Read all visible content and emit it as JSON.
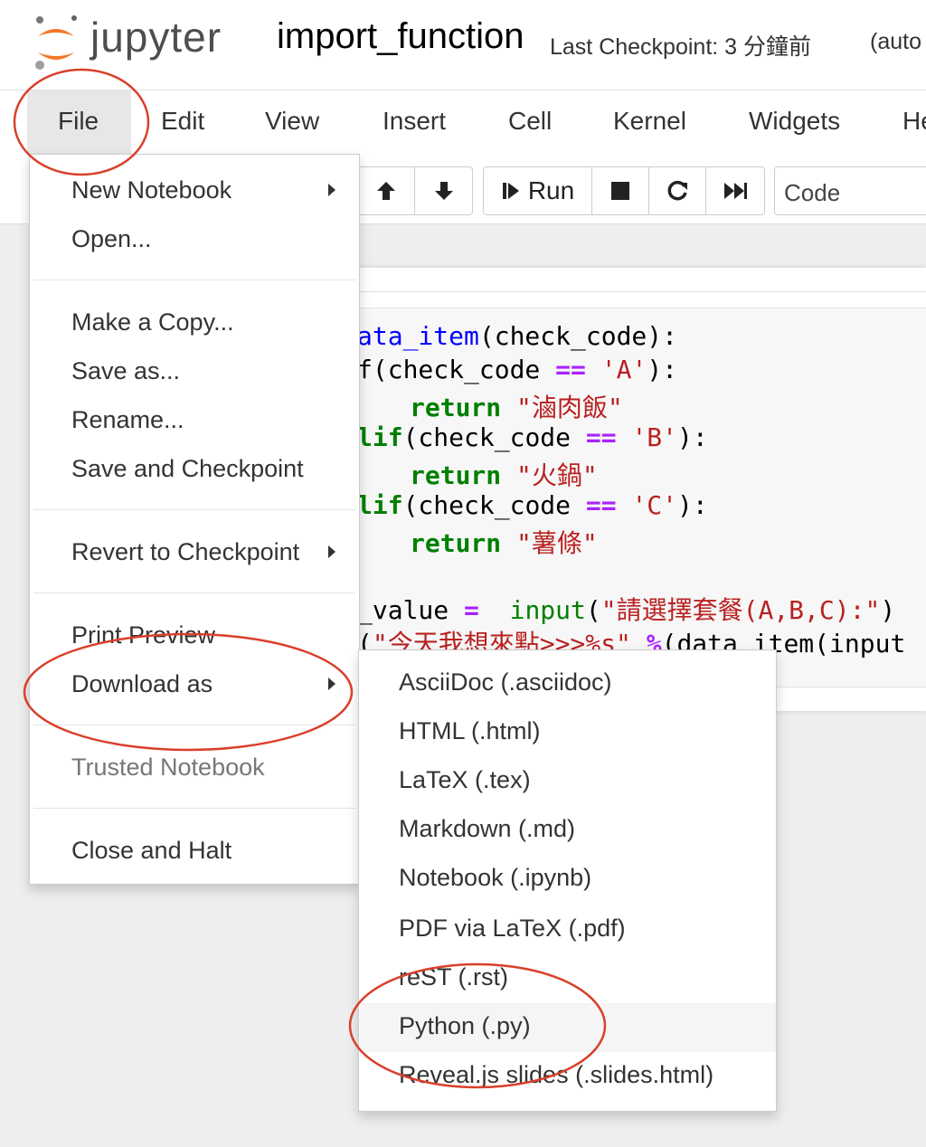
{
  "header": {
    "logo_text": "jupyter",
    "notebook_title": "import_function",
    "checkpoint": "Last Checkpoint: 3 分鐘前",
    "autosave": "(auto"
  },
  "menubar": {
    "items": [
      "File",
      "Edit",
      "View",
      "Insert",
      "Cell",
      "Kernel",
      "Widgets",
      "He"
    ]
  },
  "toolbar": {
    "run_label": "Run",
    "cell_type": "Code"
  },
  "code": {
    "lines": [
      [
        "ata_item",
        "(check_code):"
      ],
      [
        "f(check_code ",
        "==",
        " ",
        "'A'",
        "):"
      ],
      [
        "return",
        " ",
        "\"滷肉飯\""
      ],
      [
        "lif",
        "(check_code ",
        "==",
        " ",
        "'B'",
        "):"
      ],
      [
        "return",
        " ",
        "\"火鍋\""
      ],
      [
        "lif",
        "(check_code ",
        "==",
        " ",
        "'C'",
        "):"
      ],
      [
        "return",
        " ",
        "\"薯條\""
      ],
      [
        "_value ",
        "=",
        "  ",
        "input",
        "(",
        "\"請選擇套餐(A,B,C):\"",
        ")"
      ],
      [
        "(",
        "\"今天我想來點>>>%s\"",
        " ",
        "%",
        "(data_item(input"
      ]
    ]
  },
  "file_menu": {
    "items": [
      "New Notebook",
      "Open...",
      "Make a Copy...",
      "Save as...",
      "Rename...",
      "Save and Checkpoint",
      "Revert to Checkpoint",
      "Print Preview",
      "Download as",
      "Trusted Notebook",
      "Close and Halt"
    ]
  },
  "download_menu": {
    "items": [
      "AsciiDoc (.asciidoc)",
      "HTML (.html)",
      "LaTeX (.tex)",
      "Markdown (.md)",
      "Notebook (.ipynb)",
      "PDF via LaTeX (.pdf)",
      "reST (.rst)",
      "Python (.py)",
      "Reveal.js slides (.slides.html)"
    ],
    "highlighted": "Python (.py)"
  },
  "colors": {
    "annotation": "#d9402b",
    "logo_orange": "#f37726",
    "logo_gray": "#767677"
  }
}
